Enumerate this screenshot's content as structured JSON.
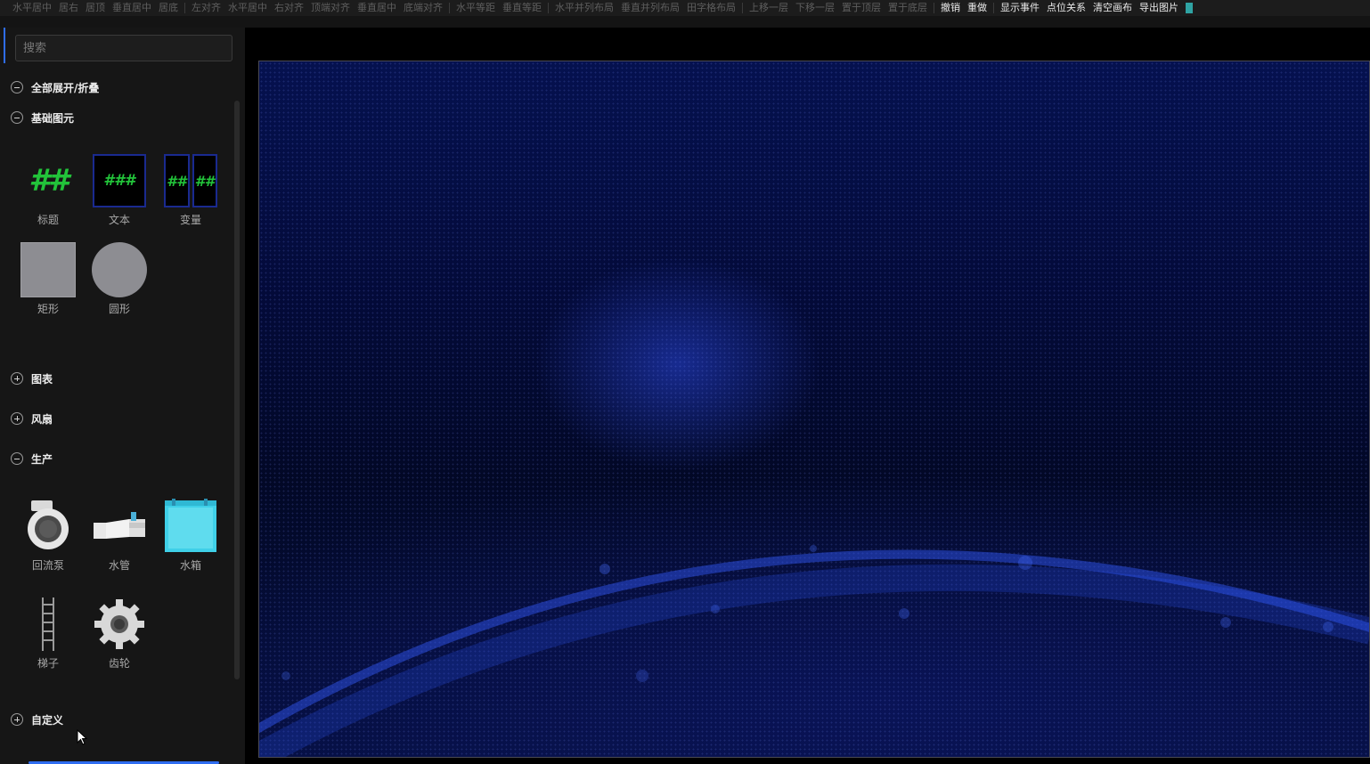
{
  "toolbar": {
    "items": [
      {
        "label": "水平居中",
        "active": false
      },
      {
        "label": "居右",
        "active": false
      },
      {
        "label": "居顶",
        "active": false
      },
      {
        "label": "垂直居中",
        "active": false
      },
      {
        "label": "居底",
        "active": false
      },
      {
        "label": "左对齐",
        "active": false
      },
      {
        "label": "水平居中",
        "active": false
      },
      {
        "label": "右对齐",
        "active": false
      },
      {
        "label": "顶端对齐",
        "active": false
      },
      {
        "label": "垂直居中",
        "active": false
      },
      {
        "label": "底端对齐",
        "active": false
      },
      {
        "label": "水平等距",
        "active": false
      },
      {
        "label": "垂直等距",
        "active": false
      },
      {
        "label": "水平并列布局",
        "active": false
      },
      {
        "label": "垂直并列布局",
        "active": false
      },
      {
        "label": "田字格布局",
        "active": false
      },
      {
        "label": "上移一层",
        "active": false
      },
      {
        "label": "下移一层",
        "active": false
      },
      {
        "label": "置于顶层",
        "active": false
      },
      {
        "label": "置于底层",
        "active": false
      },
      {
        "label": "撤销",
        "active": true
      },
      {
        "label": "重做",
        "active": true
      },
      {
        "label": "显示事件",
        "active": true
      },
      {
        "label": "点位关系",
        "active": true
      },
      {
        "label": "清空画布",
        "active": true
      },
      {
        "label": "导出图片",
        "active": true
      }
    ]
  },
  "sidebar": {
    "search_placeholder": "搜索",
    "expand_all": "全部展开/折叠",
    "groups": {
      "basic": {
        "label": "基础图元",
        "items": [
          "标题",
          "文本",
          "变量",
          "矩形",
          "圆形"
        ]
      },
      "chart": {
        "label": "图表"
      },
      "fan": {
        "label": "风扇"
      },
      "production": {
        "label": "生产",
        "items": [
          "回流泵",
          "水管",
          "水箱",
          "梯子",
          "齿轮"
        ]
      },
      "custom": {
        "label": "自定义"
      }
    },
    "icon_text": {
      "title_hash": "##",
      "text_hash": "###",
      "var_hash_left": "##",
      "var_hash_right": "##"
    }
  },
  "colors": {
    "accent": "#2f6df0",
    "hash_green": "#22c33a",
    "canvas_blue": "#05114f",
    "tank_cyan": "#3fd0e8"
  }
}
